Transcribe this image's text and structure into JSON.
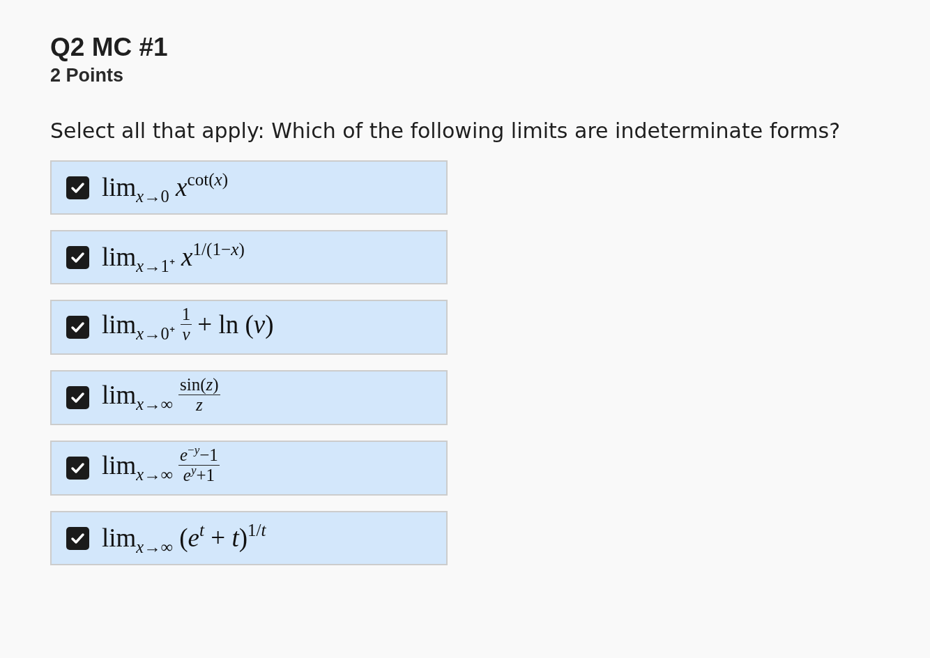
{
  "question": {
    "title": "Q2 MC #1",
    "points": "2 Points",
    "prompt": "Select all that apply: Which of the following limits are indeterminate forms?"
  },
  "options": [
    {
      "checked": true,
      "math": [
        {
          "kind": "text",
          "text": "lim"
        },
        {
          "kind": "sub",
          "text": "*x*→0"
        },
        {
          "kind": "text",
          "text": " *x*"
        },
        {
          "kind": "sup",
          "text": "cot(*x*)"
        }
      ]
    },
    {
      "checked": true,
      "math": [
        {
          "kind": "text",
          "text": "lim"
        },
        {
          "kind": "sub",
          "text": "*x*→1⁺"
        },
        {
          "kind": "text",
          "text": " *x*"
        },
        {
          "kind": "sup",
          "text": "1/(1−*x*)"
        }
      ]
    },
    {
      "checked": true,
      "math": [
        {
          "kind": "text",
          "text": "lim"
        },
        {
          "kind": "sub",
          "text": "*x*→0⁺"
        },
        {
          "kind": "frac",
          "numerator": [
            {
              "kind": "text",
              "text": "1"
            }
          ],
          "denominator": [
            {
              "kind": "text",
              "text": "*v*"
            }
          ]
        },
        {
          "kind": "text",
          "text": "+ ln (*v*)"
        }
      ]
    },
    {
      "checked": true,
      "math": [
        {
          "kind": "text",
          "text": "lim"
        },
        {
          "kind": "sub",
          "text": "*x*→∞"
        },
        {
          "kind": "frac",
          "numerator": [
            {
              "kind": "text",
              "text": "sin(*z*)"
            }
          ],
          "denominator": [
            {
              "kind": "text",
              "text": "*z*"
            }
          ]
        }
      ]
    },
    {
      "checked": true,
      "math": [
        {
          "kind": "text",
          "text": "lim"
        },
        {
          "kind": "sub",
          "text": "*x*→∞"
        },
        {
          "kind": "frac",
          "numerator": [
            {
              "kind": "text",
              "text": "*e*"
            },
            {
              "kind": "sup",
              "text": "−*y*"
            },
            {
              "kind": "text",
              "text": "−1"
            }
          ],
          "denominator": [
            {
              "kind": "text",
              "text": "*e*"
            },
            {
              "kind": "sup",
              "text": "*y*"
            },
            {
              "kind": "text",
              "text": "+1"
            }
          ]
        }
      ]
    },
    {
      "checked": true,
      "math": [
        {
          "kind": "text",
          "text": "lim"
        },
        {
          "kind": "sub",
          "text": "*x*→∞"
        },
        {
          "kind": "text",
          "text": " (*e*"
        },
        {
          "kind": "sup",
          "text": "*t*"
        },
        {
          "kind": "text",
          "text": " + *t*)"
        },
        {
          "kind": "sup",
          "text": "1/*t*"
        }
      ]
    }
  ]
}
